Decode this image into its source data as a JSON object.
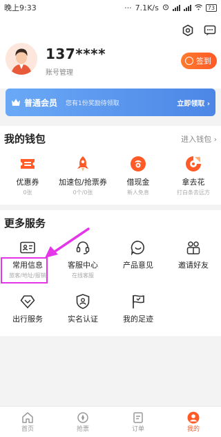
{
  "status": {
    "time": "晚上9:33",
    "dots": "···",
    "speed": "7.1K/s",
    "battery": "73"
  },
  "header": {
    "username": "137****",
    "account_link": "账号管理",
    "signin_label": "签到"
  },
  "banner": {
    "title": "普通会员",
    "subtitle": "您有1份奖励待领取",
    "action": "立即领取 ›"
  },
  "wallet": {
    "title": "我的钱包",
    "enter": "进入钱包 ›",
    "items": [
      {
        "label": "优惠券",
        "sub": "0张",
        "icon": "coupon-icon"
      },
      {
        "label": "加速包/抢票券",
        "sub": "0个/0张",
        "icon": "rocket-icon"
      },
      {
        "label": "借现金",
        "sub": "新人免息",
        "icon": "cash-icon"
      },
      {
        "label": "拿去花",
        "sub": "打白条去远方",
        "icon": "credit-icon"
      }
    ]
  },
  "services": {
    "title": "更多服务",
    "items": [
      {
        "label": "常用信息",
        "sub": "旅客/地址/报销",
        "icon": "id-card-icon"
      },
      {
        "label": "客服中心",
        "sub": "在线客服",
        "icon": "headset-icon"
      },
      {
        "label": "产品意见",
        "sub": "",
        "icon": "feedback-icon"
      },
      {
        "label": "邀请好友",
        "sub": "",
        "icon": "invite-icon"
      },
      {
        "label": "出行服务",
        "sub": "",
        "icon": "travel-icon"
      },
      {
        "label": "实名认证",
        "sub": "",
        "icon": "verify-icon"
      },
      {
        "label": "我的足迹",
        "sub": "",
        "icon": "flag-icon"
      }
    ]
  },
  "tabs": [
    {
      "label": "首页",
      "icon": "home-icon"
    },
    {
      "label": "抢票",
      "icon": "ticket-icon"
    },
    {
      "label": "订单",
      "icon": "order-icon"
    },
    {
      "label": "我的",
      "icon": "mine-icon",
      "active": true
    }
  ],
  "colors": {
    "accent": "#ff5a28",
    "banner": "#5d97ee",
    "highlight": "#e535e8"
  }
}
